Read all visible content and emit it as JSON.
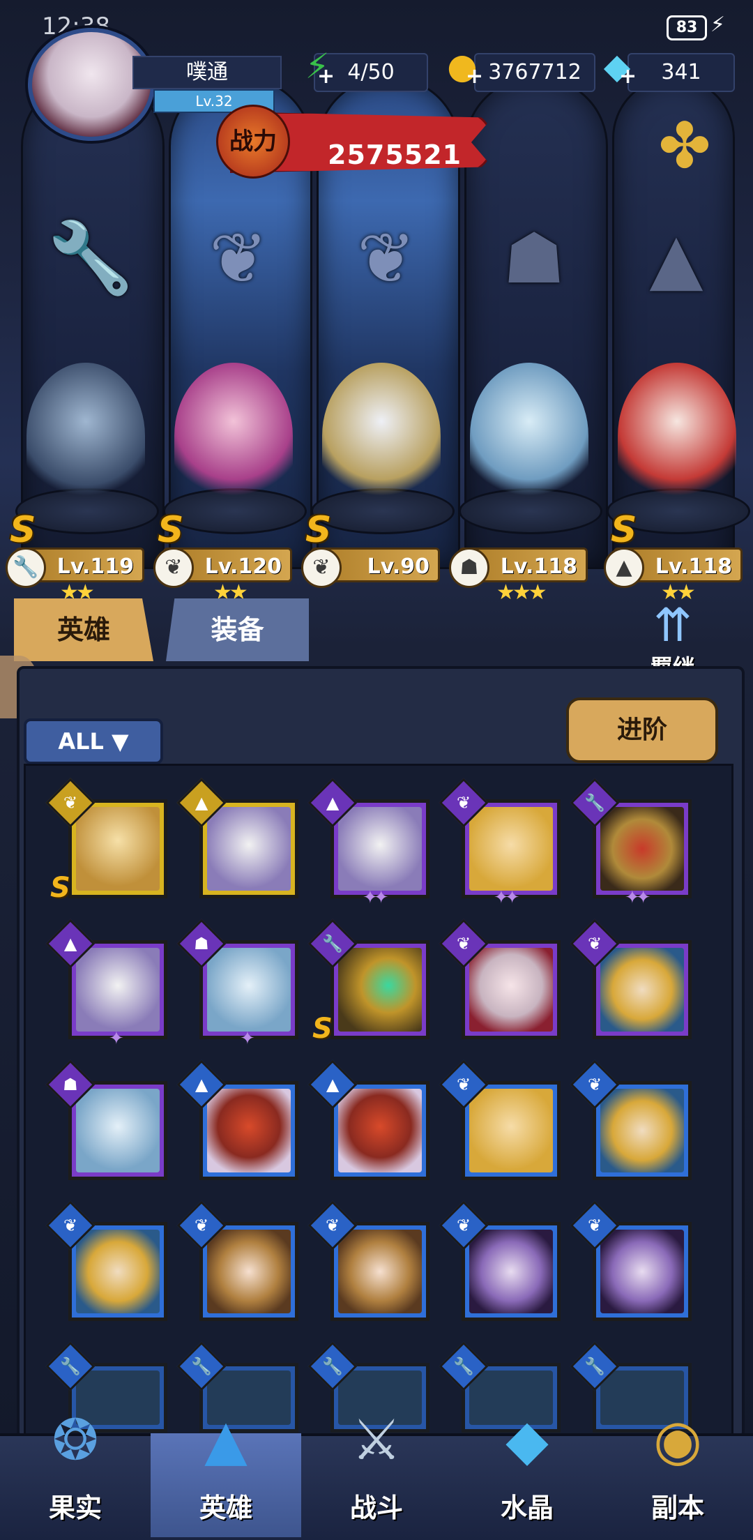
{
  "status": {
    "time": "12:38",
    "battery": "83"
  },
  "player": {
    "name": "噗通",
    "level": "Lv.32"
  },
  "resources": {
    "stamina": "4/50",
    "gold": "3767712",
    "gems": "341"
  },
  "power": {
    "label": "战力",
    "value": "2575521"
  },
  "featured_heroes": [
    {
      "level": "Lv.119",
      "rank": "S",
      "class_icon": "wrench-icon",
      "stars": "★★"
    },
    {
      "level": "Lv.120",
      "rank": "S",
      "class_icon": "wing-icon",
      "stars": "★★"
    },
    {
      "level": "Lv.90",
      "rank": "S",
      "class_icon": "wing-icon",
      "stars": ""
    },
    {
      "level": "Lv.118",
      "rank": "",
      "class_icon": "beast-icon",
      "stars": "★★★"
    },
    {
      "level": "Lv.118",
      "rank": "S",
      "class_icon": "flask-icon",
      "stars": "★★"
    }
  ],
  "tabs": {
    "heroes": "英雄",
    "equipment": "装备"
  },
  "bond": {
    "label": "羁绊"
  },
  "filter": {
    "label": "ALL ▼"
  },
  "advance": {
    "label": "进阶"
  },
  "nav": [
    {
      "label": "果实"
    },
    {
      "label": "英雄"
    },
    {
      "label": "战斗"
    },
    {
      "label": "水晶"
    },
    {
      "label": "副本"
    }
  ]
}
